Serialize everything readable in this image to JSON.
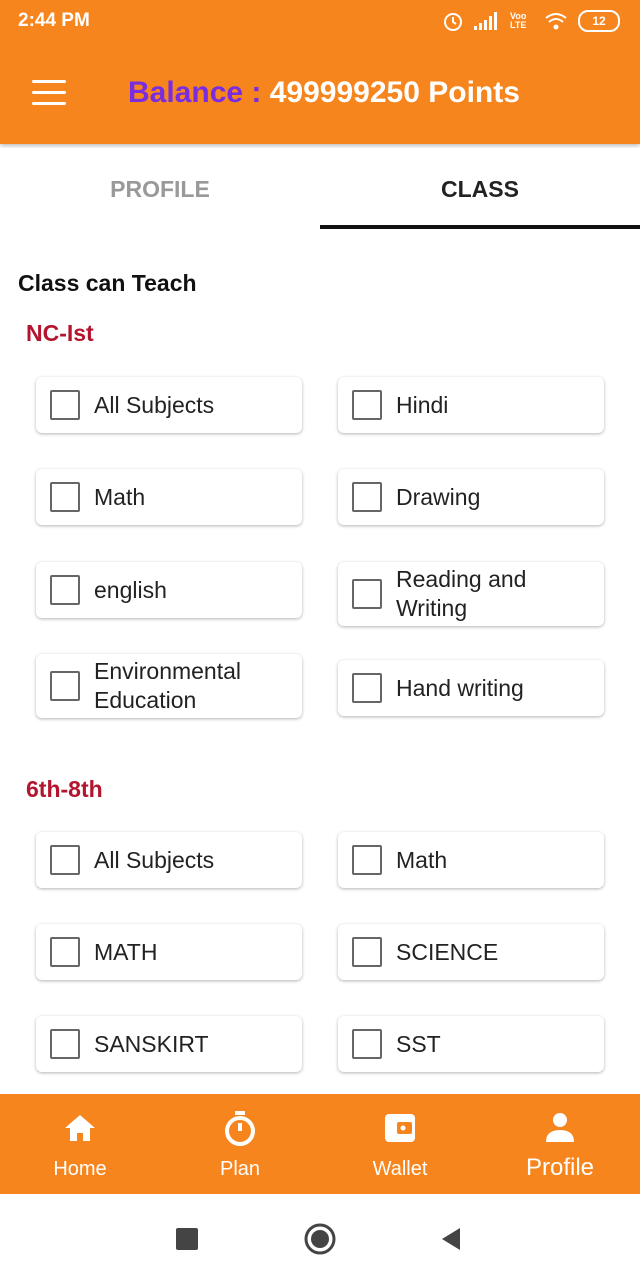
{
  "status_bar": {
    "time": "2:44 PM",
    "carrier": "Voo LTE",
    "battery": "12"
  },
  "header": {
    "balance_label": "Balance :",
    "balance_value": "499999250 Points",
    "menu_icon": "hamburger-icon"
  },
  "tabs": [
    {
      "label": "PROFILE",
      "selected": false
    },
    {
      "label": "CLASS",
      "selected": true
    }
  ],
  "section_heading": "Class can Teach",
  "groups": [
    {
      "title": "NC-Ist",
      "subjects": [
        "All Subjects",
        "Hindi",
        "Math",
        "Drawing",
        "english",
        "Reading and Writing",
        "Environmental Education",
        "Hand writing"
      ]
    },
    {
      "title": "6th-8th",
      "subjects": [
        "All Subjects",
        "Math",
        "MATH",
        "SCIENCE",
        "SANSKIRT",
        "SST"
      ]
    }
  ],
  "bottom_nav": [
    {
      "label": "Home",
      "icon": "home-icon"
    },
    {
      "label": "Plan",
      "icon": "timer-icon"
    },
    {
      "label": "Wallet",
      "icon": "wallet-icon"
    },
    {
      "label": "Profile",
      "icon": "person-icon",
      "active": true
    }
  ],
  "colors": {
    "accent": "#f7851d",
    "balance_label": "#7a2de0",
    "group_title": "#b3142e"
  }
}
